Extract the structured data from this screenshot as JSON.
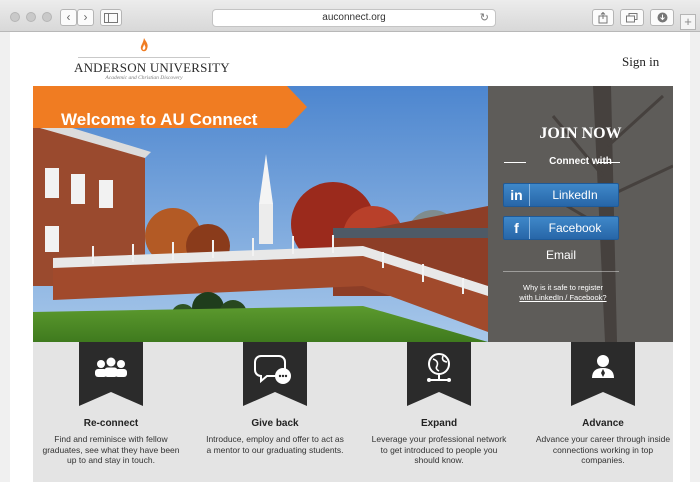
{
  "browser": {
    "url": "auconnect.org"
  },
  "header": {
    "logo_name": "ANDERSON UNIVERSITY",
    "logo_tagline": "Academic and Christian Discovery",
    "signin": "Sign in"
  },
  "hero": {
    "banner": "Welcome to AU Connect",
    "join_title": "JOIN NOW",
    "connect_with": "Connect with",
    "linkedin": "LinkedIn",
    "linkedin_icon": "in",
    "facebook": "Facebook",
    "facebook_icon": "f",
    "email": "Email",
    "safe_line1": "Why is it safe to register",
    "safe_line2": "with LinkedIn / Facebook?"
  },
  "features": [
    {
      "icon": "people-icon",
      "title": "Re-connect",
      "desc": "Find and reminisce with fellow graduates, see what they have been up to and stay in touch."
    },
    {
      "icon": "chat-icon",
      "title": "Give back",
      "desc": "Introduce, employ and offer to act as a mentor to our graduating students."
    },
    {
      "icon": "globe-icon",
      "title": "Expand",
      "desc": "Leverage your professional network to get introduced to people you should know."
    },
    {
      "icon": "user-icon",
      "title": "Advance",
      "desc": "Advance your career through inside connections working in top companies."
    }
  ],
  "colors": {
    "banner": "#f07c22",
    "social": "#2f78bd",
    "ribbon": "#2b2b2b"
  }
}
